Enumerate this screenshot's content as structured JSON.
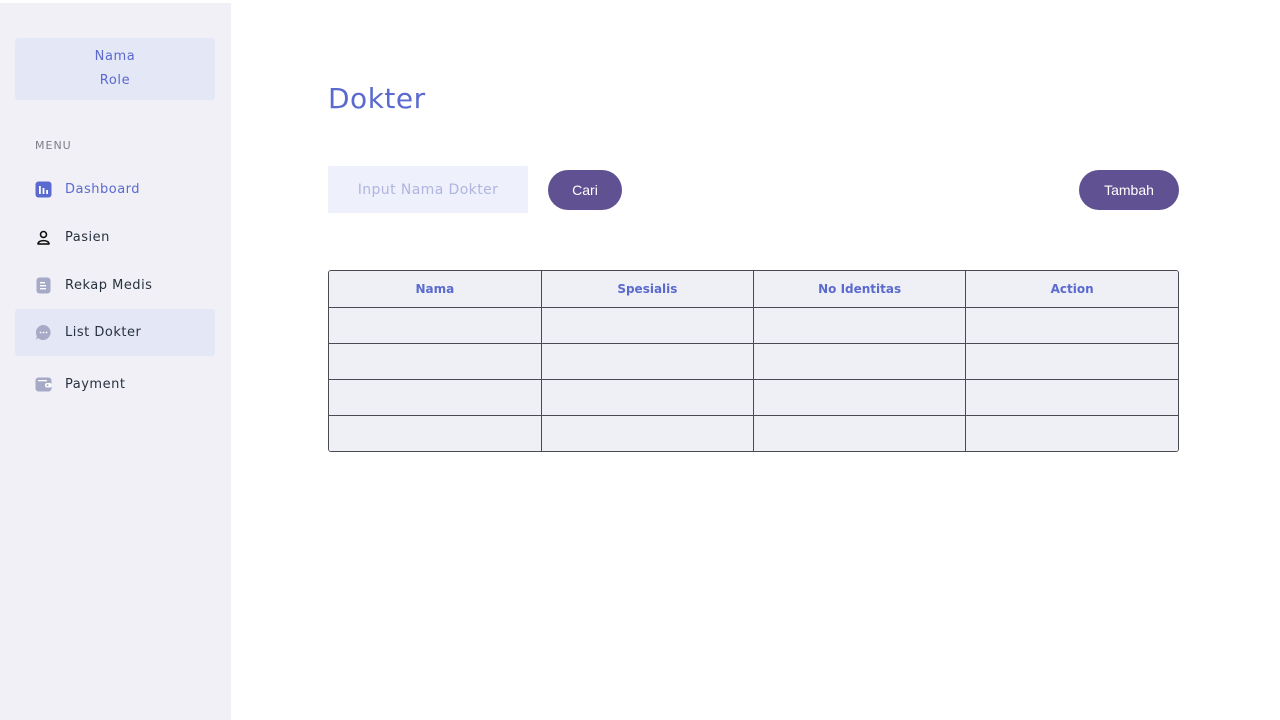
{
  "sidebar": {
    "profile": {
      "name": "Nama",
      "role": "Role"
    },
    "menu_label": "MENU",
    "items": [
      {
        "label": "Dashboard",
        "icon": "chart-icon"
      },
      {
        "label": "Pasien",
        "icon": "person-icon"
      },
      {
        "label": "Rekap Medis",
        "icon": "document-icon"
      },
      {
        "label": "List Dokter",
        "icon": "chat-icon"
      },
      {
        "label": "Payment",
        "icon": "wallet-icon"
      }
    ]
  },
  "main": {
    "title": "Dokter",
    "search": {
      "placeholder": "Input Nama Dokter",
      "value": ""
    },
    "search_button": "Cari",
    "add_button": "Tambah",
    "table": {
      "columns": [
        "Nama",
        "Spesialis",
        "No Identitas",
        "Action"
      ],
      "rows": [
        [
          "",
          "",
          "",
          ""
        ],
        [
          "",
          "",
          "",
          ""
        ],
        [
          "",
          "",
          "",
          ""
        ],
        [
          "",
          "",
          "",
          ""
        ]
      ]
    }
  },
  "colors": {
    "accent": "#5a6acf",
    "button": "#605192",
    "sidebar_bg": "#f0f0f6",
    "highlight_bg": "#e4e7f5",
    "table_bg": "#eff0f5"
  }
}
